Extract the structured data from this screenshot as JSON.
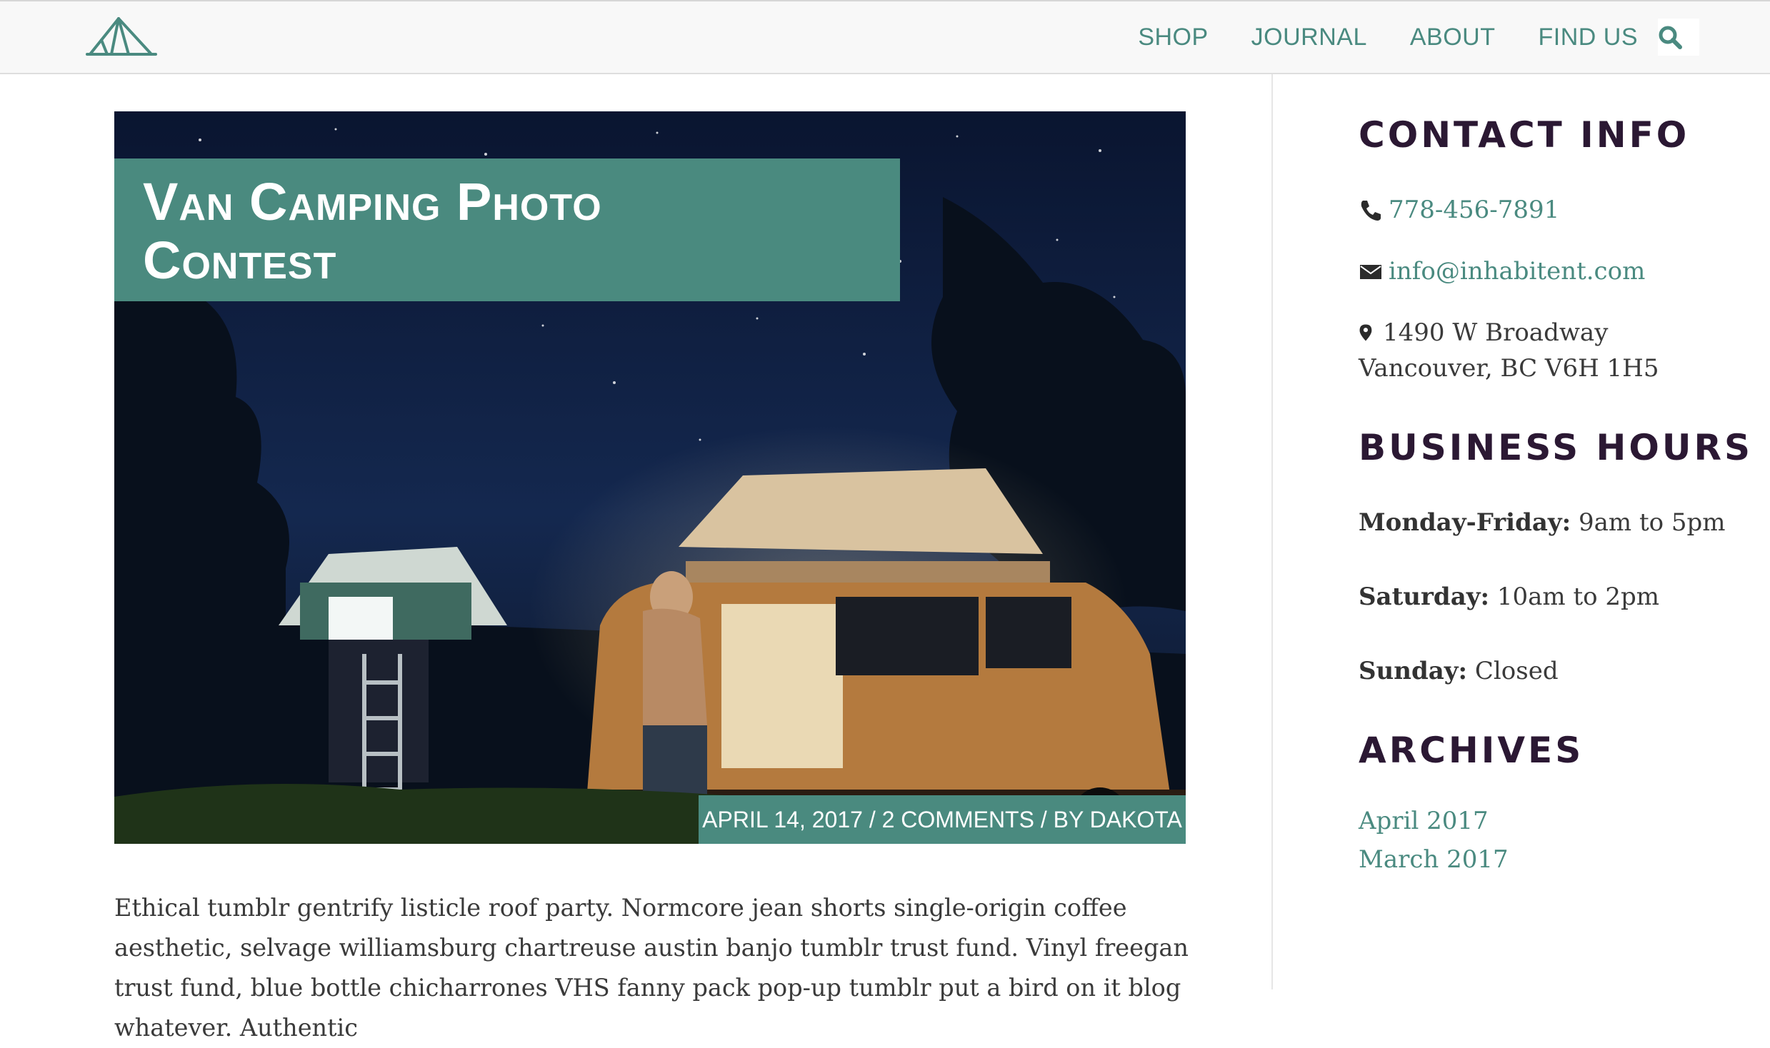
{
  "nav": {
    "items": [
      "SHOP",
      "JOURNAL",
      "ABOUT",
      "FIND US"
    ]
  },
  "icons": {
    "logo": "tent-logo-icon",
    "search": "search-icon",
    "phone": "phone-icon",
    "email": "envelope-icon",
    "location": "map-marker-icon"
  },
  "post": {
    "title_line1": "Van Camping Photo",
    "title_line2": "Contest",
    "meta": "APRIL 14, 2017 / 2 COMMENTS / BY DAKOTA",
    "body": "Ethical tumblr gentrify listicle roof party. Normcore jean shorts single-origin coffee aesthetic, selvage williamsburg chartreuse austin banjo tumblr trust fund. Vinyl freegan trust fund, blue bottle chicharrones VHS fanny pack pop-up tumblr put a bird on it blog whatever. Authentic"
  },
  "sidebar": {
    "contact_heading": "CONTACT INFO",
    "phone": "778-456-7891",
    "email": "info@inhabitent.com",
    "address_line1": "1490 W Broadway",
    "address_line2": "Vancouver, BC V6H 1H5",
    "hours_heading": "BUSINESS HOURS",
    "hours": [
      {
        "day": "Monday-Friday:",
        "time": "9am to 5pm"
      },
      {
        "day": "Saturday:",
        "time": "10am to 2pm"
      },
      {
        "day": "Sunday:",
        "time": "Closed"
      }
    ],
    "archives_heading": "ARCHIVES",
    "archives": [
      "April 2017",
      "March 2017"
    ]
  },
  "colors": {
    "accent": "#4a8a7f",
    "heading": "#2b1833",
    "text": "#3a3a3a"
  }
}
